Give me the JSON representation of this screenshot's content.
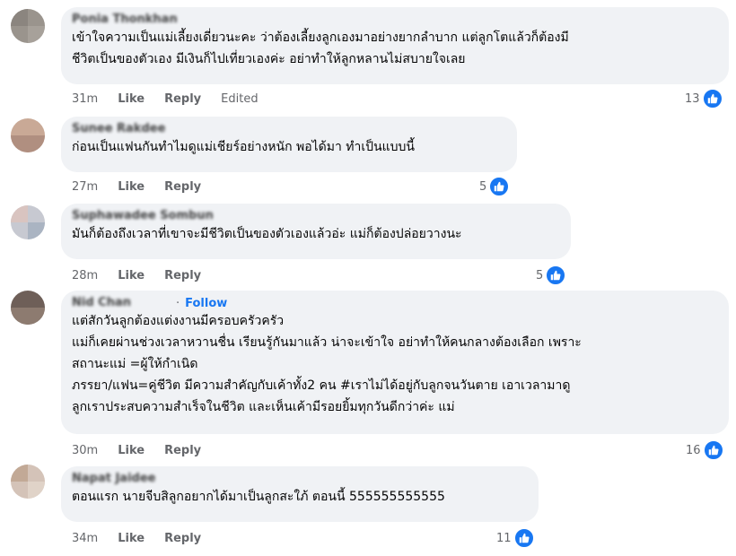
{
  "actions": {
    "like": "Like",
    "reply": "Reply"
  },
  "comments": [
    {
      "author": "Ponia Thonkhan",
      "lines": [
        "เข้าใจความเป็นแม่เลี้ยงเดี่ยวนะคะ ว่าต้องเลี้ยงลูกเองมาอย่างยากลำบาก แต่ลูกโตแล้วก็ต้องมี",
        "ชีวิตเป็นของตัวเอง มีเงินก็ไปเที่ยวเองค่ะ อย่าทำให้ลูกหลานไม่สบายใจเลย"
      ],
      "time": "31m",
      "edited": "Edited",
      "reactions": "13"
    },
    {
      "author": "Sunee Rakdee",
      "lines": [
        "ก่อนเป็นแฟนกันทำไมดูแม่เชียร์อย่างหนัก พอได้มา ทำเป็นแบบนี้"
      ],
      "time": "27m",
      "reactions": "5"
    },
    {
      "author": "Suphawadee Sombun",
      "lines": [
        "มันก็ต้องถึงเวลาที่เขาจะมีชีวิตเป็นของตัวเองแล้วอ่ะ แม่ก็ต้องปล่อยวางนะ"
      ],
      "time": "28m",
      "reactions": "5"
    },
    {
      "author": "Nid Chan",
      "follow": "Follow",
      "lines": [
        "แต่สักวันลูกต้องแต่งงานมีครอบครัวครัว",
        "แม่ก็เคยผ่านช่วงเวลาหวานชื่น เรียนรู้กันมาแล้ว น่าจะเข้าใจ อย่าทำให้คนกลางต้องเลือก เพราะ",
        "สถานะแม่ =ผู้ให้กำเนิด",
        "ภรรยา/แฟน=คู่ชีวิต มีความสำคัญกับเค้าทั้ง2 คน #เราไม่ได้อยู่กับลูกจนวันตาย เอาเวลามาดู",
        "ลูกเราประสบความสำเร็จในชีวิต และเห็นเค้ามีรอยยิ้มทุกวันดีกว่าค่ะ แม่"
      ],
      "time": "30m",
      "reactions": "16"
    },
    {
      "author": "Napat Jaidee",
      "lines": [
        "ตอนแรก นายจีบสิลูกอยากได้มาเป็นลูกสะใภ้ ตอนนี้ 555555555555"
      ],
      "time": "34m",
      "reactions": "11"
    }
  ]
}
